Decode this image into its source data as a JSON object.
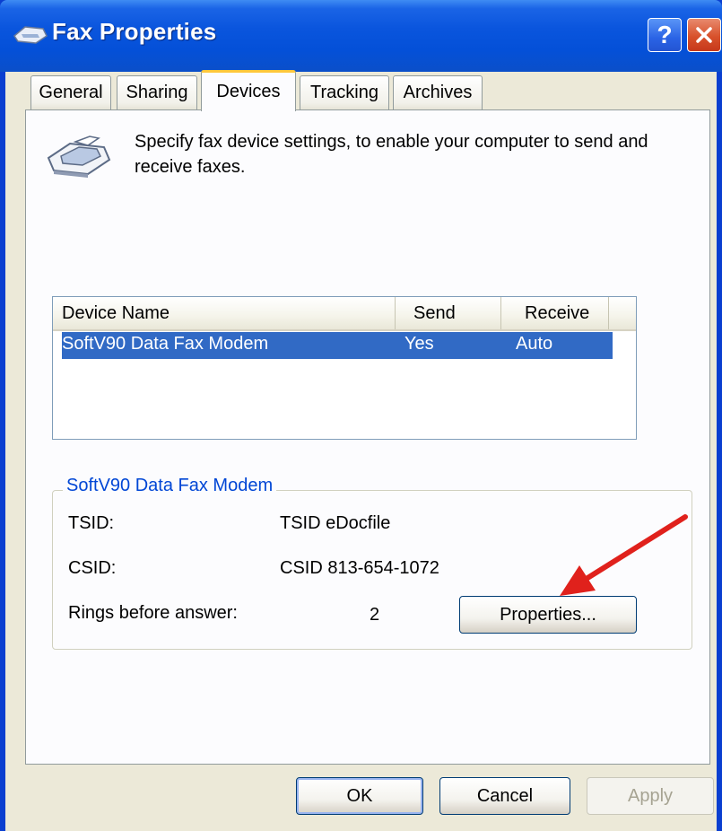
{
  "window": {
    "title": "Fax Properties"
  },
  "tabs": [
    {
      "label": "General"
    },
    {
      "label": "Sharing"
    },
    {
      "label": "Devices",
      "active": true
    },
    {
      "label": "Tracking"
    },
    {
      "label": "Archives"
    }
  ],
  "intro_text": "Specify fax device settings, to enable your computer to send and receive faxes.",
  "device_list": {
    "columns": [
      "Device Name",
      "Send",
      "Receive"
    ],
    "rows": [
      {
        "name": "SoftV90 Data Fax Modem",
        "send": "Yes",
        "receive": "Auto",
        "selected": true
      }
    ]
  },
  "device_group": {
    "title": "SoftV90 Data Fax Modem",
    "tsid_label": "TSID:",
    "tsid_value": "TSID eDocfile",
    "csid_label": "CSID:",
    "csid_value": "CSID 813-654-1072",
    "rings_label": "Rings before answer:",
    "rings_value": "2",
    "properties_button": "Properties..."
  },
  "buttons": {
    "ok": "OK",
    "cancel": "Cancel",
    "apply": "Apply"
  },
  "colors": {
    "title_bar": "#0a55dd",
    "selection": "#316ac5",
    "group_title": "#0046d5",
    "annotation_arrow": "#e0211c"
  }
}
